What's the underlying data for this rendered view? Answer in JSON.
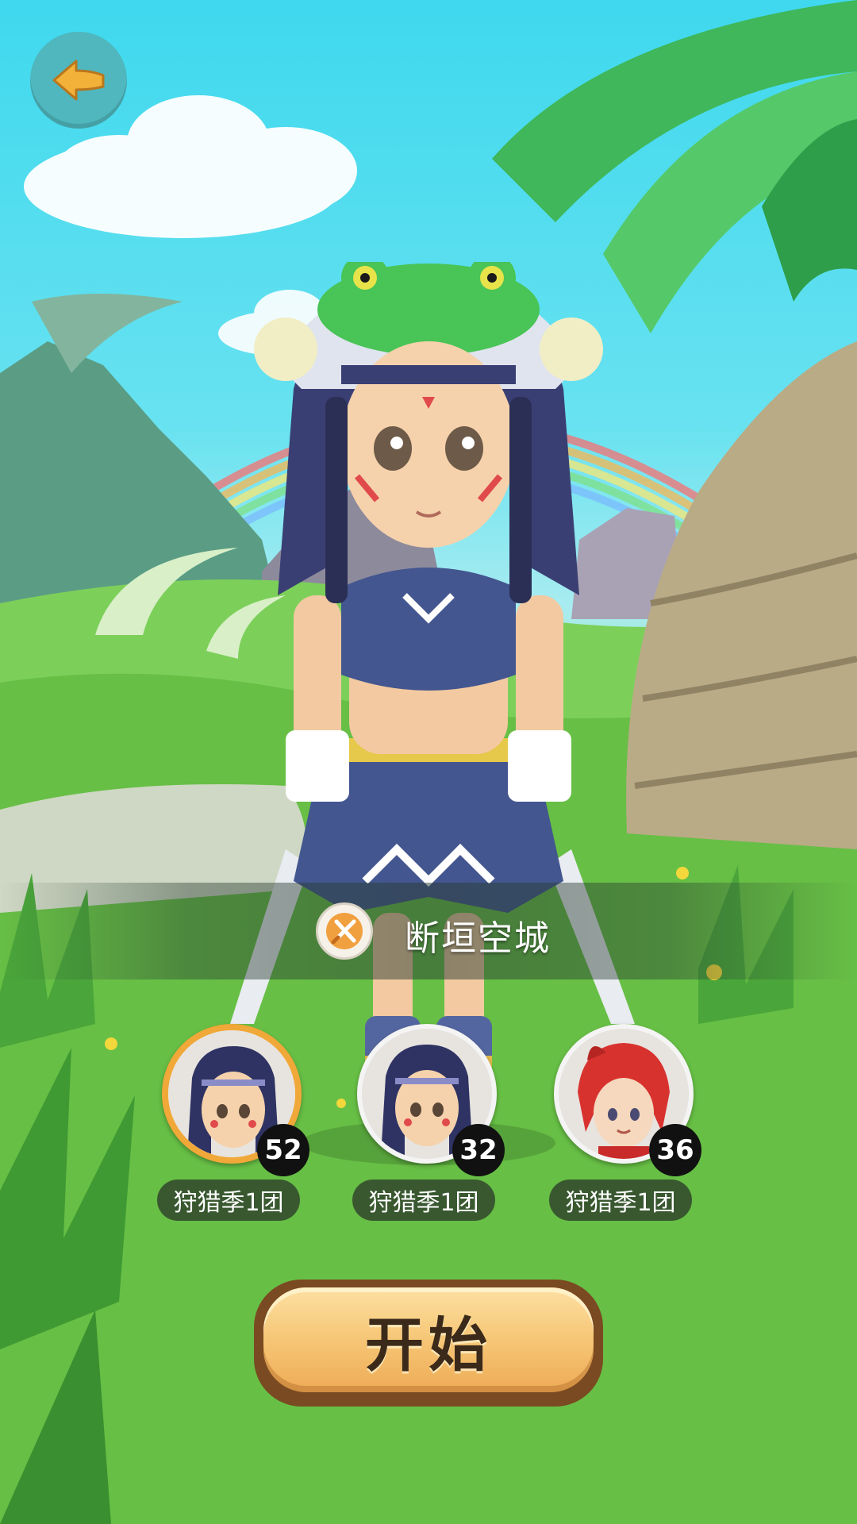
{
  "top_bar": {
    "back_icon": "arrow-left-icon"
  },
  "map": {
    "icon": "crossed-swords-icon",
    "name": "断垣空城"
  },
  "team": [
    {
      "level": "52",
      "label": "狩猎季1团",
      "selected": true
    },
    {
      "level": "32",
      "label": "狩猎季1团",
      "selected": false
    },
    {
      "level": "36",
      "label": "狩猎季1团",
      "selected": false
    }
  ],
  "start_button": {
    "label": "开始"
  },
  "colors": {
    "back_button_bg": "#4fb7bd",
    "back_arrow": "#f2b23a",
    "selected_ring": "#f0a838",
    "start_button": "#f6c676"
  }
}
